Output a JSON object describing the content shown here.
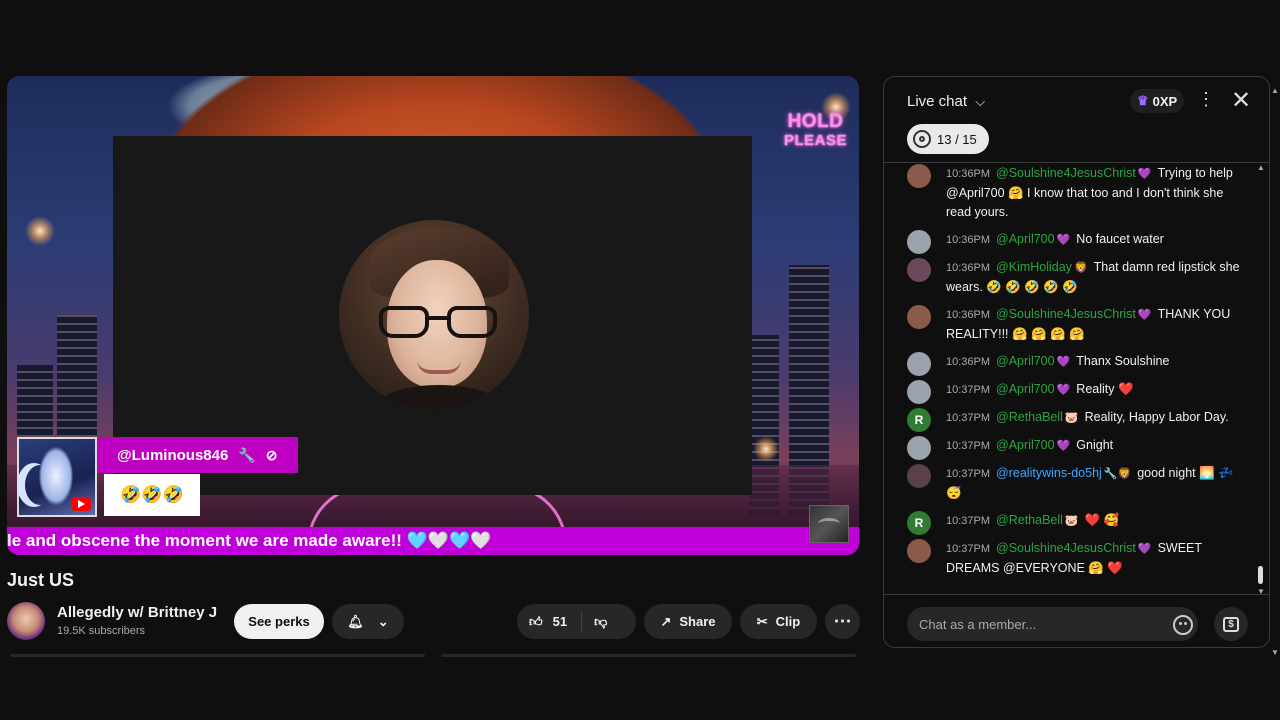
{
  "player": {
    "hold_line1": "HOLD",
    "hold_line2": "PLEASE",
    "overlay_username": "@Luminous846",
    "overlay_emojis": "🤣🤣🤣",
    "ticker_text": "le and obscene the moment we are made aware!! 🩵🤍🩵🤍"
  },
  "video": {
    "title": "Just US",
    "channel_name": "Allegedly w/ Brittney J",
    "subscribers": "19.5K subscribers",
    "see_perks": "See perks",
    "like_count": "51",
    "share_label": "Share",
    "clip_label": "Clip"
  },
  "chat": {
    "title": "Live chat",
    "xp": "0XP",
    "goal": "13 / 15",
    "input_placeholder": "Chat as a member...",
    "messages": [
      {
        "time": "10:36PM",
        "author": "@Soulshine4JesusChrist",
        "badge": "💜",
        "text": "Trying to help @April700 🤗 I know that too and I don't think she read yours.",
        "avatar_color": "#8a5a4a"
      },
      {
        "time": "10:36PM",
        "author": "@April700",
        "badge": "💜",
        "text": "No faucet water",
        "avatar_color": "#9aa3ad"
      },
      {
        "time": "10:36PM",
        "author": "@KimHoliday",
        "badge": "🦁",
        "text": "That damn red lipstick she wears. 🤣 🤣 🤣 🤣 🤣",
        "avatar_color": "#6a4a5a"
      },
      {
        "time": "10:36PM",
        "author": "@Soulshine4JesusChrist",
        "badge": "💜",
        "text": "THANK YOU REALITY!!! 🤗 🤗 🤗 🤗",
        "avatar_color": "#8a5a4a"
      },
      {
        "time": "10:36PM",
        "author": "@April700",
        "badge": "💜",
        "text": "Thanx Soulshine",
        "avatar_color": "#9aa3ad"
      },
      {
        "time": "10:37PM",
        "author": "@April700",
        "badge": "💜",
        "text": "Reality ❤️",
        "avatar_color": "#9aa3ad"
      },
      {
        "time": "10:37PM",
        "author": "@RethaBell",
        "badge": "🐷",
        "text": "Reality, Happy Labor Day.",
        "avatar_color": "#2e7d32",
        "initial": "R"
      },
      {
        "time": "10:37PM",
        "author": "@April700",
        "badge": "💜",
        "text": "Gnight",
        "avatar_color": "#9aa3ad"
      },
      {
        "time": "10:37PM",
        "author": "@realitywins-do5hj",
        "badge": "🔧🦁",
        "text": "good night 🌅 💤 😴",
        "avatar_color": "#5a4048",
        "blue": true
      },
      {
        "time": "10:37PM",
        "author": "@RethaBell",
        "badge": "🐷",
        "text": "❤️ 🥰",
        "avatar_color": "#2e7d32",
        "initial": "R"
      },
      {
        "time": "10:37PM",
        "author": "@Soulshine4JesusChrist",
        "badge": "💜",
        "text": "SWEET DREAMS @EVERYONE 🤗 ❤️",
        "avatar_color": "#8a5a4a"
      }
    ]
  },
  "colors": {
    "accent_purple": "#c000d8",
    "author_green": "#2ba640",
    "author_blue": "#3ea6ff"
  }
}
